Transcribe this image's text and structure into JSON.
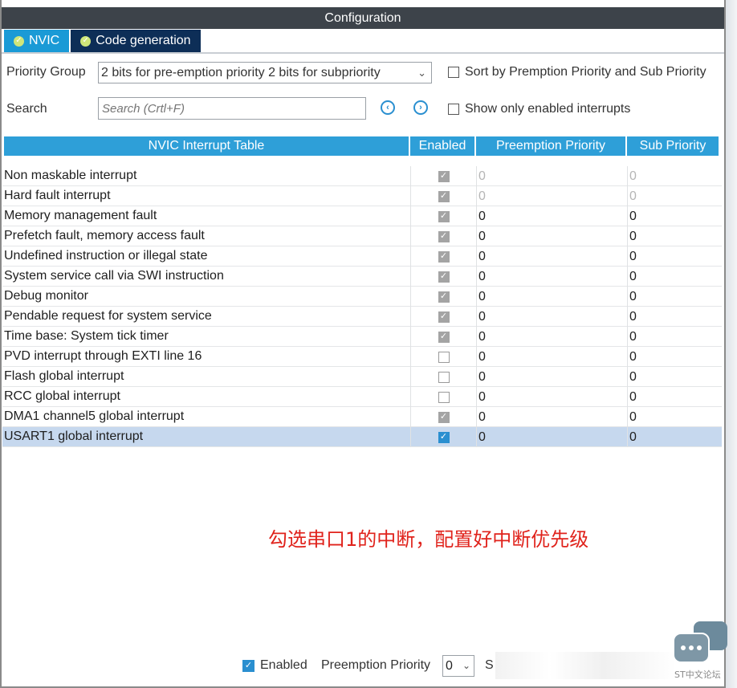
{
  "window": {
    "title": "Configuration"
  },
  "tabs": [
    {
      "label": "NVIC",
      "icon": "check-circle-icon",
      "active": true
    },
    {
      "label": "Code generation",
      "icon": "check-circle-icon",
      "active": false
    }
  ],
  "controls": {
    "priority_group_label": "Priority Group",
    "priority_group_value": "2 bits for pre-emption priority 2 bits for subpriority",
    "sort_label": "Sort by Premption Priority and Sub Priority",
    "search_label": "Search",
    "search_placeholder": "Search (Crtl+F)",
    "show_enabled_label": "Show only enabled interrupts"
  },
  "table": {
    "headers": [
      "NVIC Interrupt Table",
      "Enabled",
      "Preemption Priority",
      "Sub Priority"
    ],
    "rows": [
      {
        "name": "Non maskable interrupt",
        "enabled": true,
        "locked": true,
        "preemption": "0",
        "sub": "0",
        "dim": true
      },
      {
        "name": "Hard fault interrupt",
        "enabled": true,
        "locked": true,
        "preemption": "0",
        "sub": "0",
        "dim": true
      },
      {
        "name": "Memory management fault",
        "enabled": true,
        "locked": true,
        "preemption": "0",
        "sub": "0",
        "dim": false
      },
      {
        "name": "Prefetch fault, memory access fault",
        "enabled": true,
        "locked": true,
        "preemption": "0",
        "sub": "0",
        "dim": false
      },
      {
        "name": "Undefined instruction or illegal state",
        "enabled": true,
        "locked": true,
        "preemption": "0",
        "sub": "0",
        "dim": false
      },
      {
        "name": "System service call via SWI instruction",
        "enabled": true,
        "locked": true,
        "preemption": "0",
        "sub": "0",
        "dim": false
      },
      {
        "name": "Debug monitor",
        "enabled": true,
        "locked": true,
        "preemption": "0",
        "sub": "0",
        "dim": false
      },
      {
        "name": "Pendable request for system service",
        "enabled": true,
        "locked": true,
        "preemption": "0",
        "sub": "0",
        "dim": false
      },
      {
        "name": "Time base: System tick timer",
        "enabled": true,
        "locked": true,
        "preemption": "0",
        "sub": "0",
        "dim": false
      },
      {
        "name": "PVD interrupt through EXTI line 16",
        "enabled": false,
        "locked": false,
        "preemption": "0",
        "sub": "0",
        "dim": false
      },
      {
        "name": "Flash global interrupt",
        "enabled": false,
        "locked": false,
        "preemption": "0",
        "sub": "0",
        "dim": false
      },
      {
        "name": "RCC global interrupt",
        "enabled": false,
        "locked": false,
        "preemption": "0",
        "sub": "0",
        "dim": false
      },
      {
        "name": "DMA1 channel5 global interrupt",
        "enabled": true,
        "locked": true,
        "preemption": "0",
        "sub": "0",
        "dim": false
      },
      {
        "name": "USART1 global interrupt",
        "enabled": true,
        "locked": false,
        "selected": true,
        "preemption": "0",
        "sub": "0",
        "dim": false
      }
    ]
  },
  "annotation": "勾选串口1的中断，配置好中断优先级",
  "bottom": {
    "enabled_label": "Enabled",
    "preemption_label": "Preemption Priority",
    "preemption_value": "0",
    "sub_partial": "S"
  },
  "watermark": {
    "text": "ST中文论坛"
  },
  "colors": {
    "tab_active": "#1a9ad6",
    "tab_inactive": "#0d2e57",
    "header": "#2e9fd8",
    "selected_row": "#c6d8ee",
    "annotation": "#e0231c"
  }
}
